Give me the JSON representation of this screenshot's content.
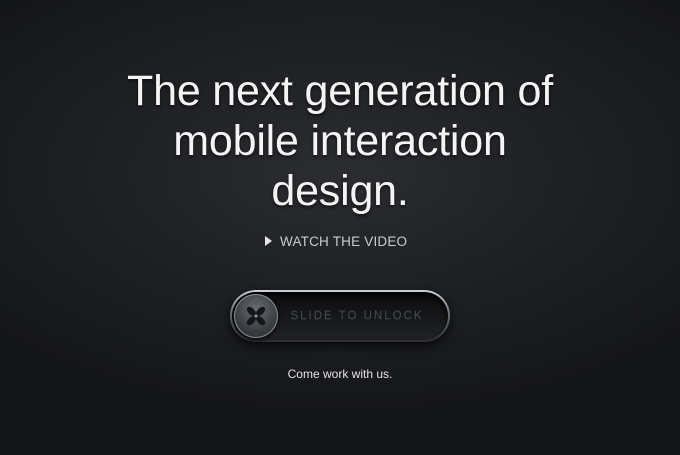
{
  "hero": {
    "headline_lines": [
      "The next generation of",
      "mobile interaction",
      "design."
    ]
  },
  "video_link": {
    "label": "WATCH THE VIDEO",
    "icon": "play-icon"
  },
  "unlock_slider": {
    "label": "SLIDE TO UNLOCK",
    "knob_icon": "flower-logo-icon"
  },
  "footer": {
    "careers_label": "Come work with us."
  },
  "colors": {
    "background": "#1f2124",
    "headline": "#f4f4f4",
    "link": "#c9cbcf",
    "slider_label": "#45484d"
  }
}
